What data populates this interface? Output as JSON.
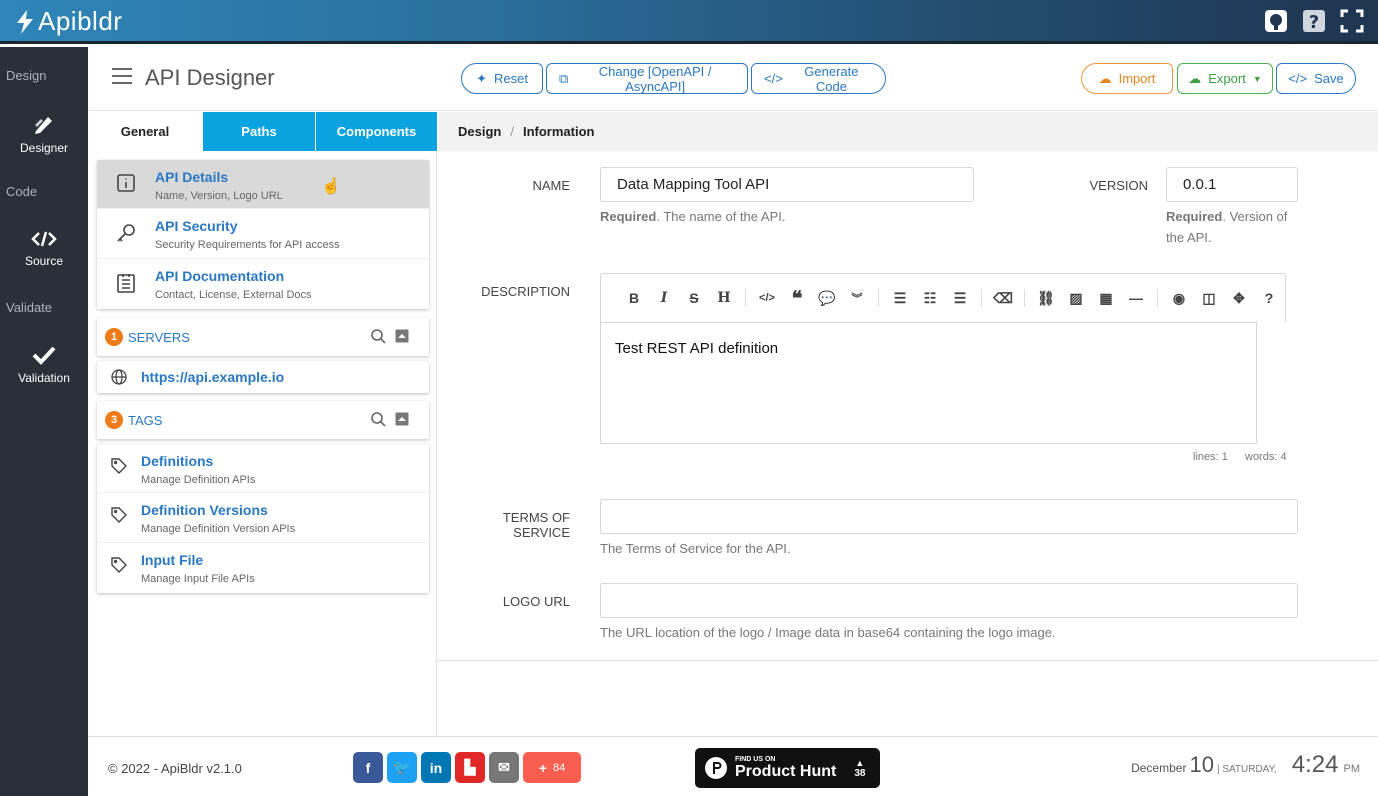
{
  "app": {
    "logo_text": "Apibldr"
  },
  "leftnav": {
    "sections": [
      "Design",
      "Code",
      "Validate"
    ],
    "items": [
      {
        "label": "Designer",
        "icon": "pencil-ruler-icon"
      },
      {
        "label": "Source",
        "icon": "code-icon"
      },
      {
        "label": "Validation",
        "icon": "checkmark-icon"
      }
    ]
  },
  "header": {
    "title": "API Designer",
    "reset": "Reset",
    "change": "Change [OpenAPI / AsyncAPI]",
    "generate": "Generate Code",
    "import": "Import",
    "export": "Export",
    "save": "Save"
  },
  "tabs": [
    "General",
    "Paths",
    "Components"
  ],
  "general_items": [
    {
      "title": "API Details",
      "sub": "Name, Version, Logo URL"
    },
    {
      "title": "API Security",
      "sub": "Security Requirements for API access"
    },
    {
      "title": "API Documentation",
      "sub": "Contact, License, External Docs"
    }
  ],
  "servers": {
    "count": "1",
    "label": "SERVERS",
    "items": [
      "https://api.example.io"
    ]
  },
  "tags": {
    "count": "3",
    "label": "TAGS",
    "items": [
      {
        "title": "Definitions",
        "sub": "Manage Definition APIs"
      },
      {
        "title": "Definition Versions",
        "sub": "Manage Definition Version APIs"
      },
      {
        "title": "Input File",
        "sub": "Manage Input File APIs"
      }
    ]
  },
  "breadcrumb": {
    "root": "Design",
    "sep": "/",
    "current": "Information"
  },
  "form": {
    "name_label": "NAME",
    "name_value": "Data Mapping Tool API",
    "name_help_bold": "Required",
    "name_help": ". The name of the API.",
    "version_label": "VERSION",
    "version_value": "0.0.1",
    "version_help_bold": "Required",
    "version_help": ". Version of the API.",
    "description_label": "DESCRIPTION",
    "description_value": "Test REST API definition",
    "lines": "lines: 1",
    "words": "words: 4",
    "tos_label": "TERMS OF SERVICE",
    "tos_value": "",
    "tos_help": "The Terms of Service for the API.",
    "logo_label": "LOGO URL",
    "logo_value": "",
    "logo_help": "The URL location of the logo / Image data in base64 containing the logo image."
  },
  "footer": {
    "copyright": "© 2022 - ApiBldr v2.1.0",
    "share_count": "84",
    "ph_small": "FIND US ON",
    "ph_big": "Product Hunt",
    "ph_votes": "38",
    "month": "December",
    "day": "10",
    "weekday": "| SATURDAY,",
    "time": "4:24",
    "ampm": "PM"
  },
  "colors": {
    "accent": "#2a78c4",
    "tab_blue": "#0aa2df",
    "badge": "#ef7a1a",
    "nav_bg": "#2b2f38"
  }
}
